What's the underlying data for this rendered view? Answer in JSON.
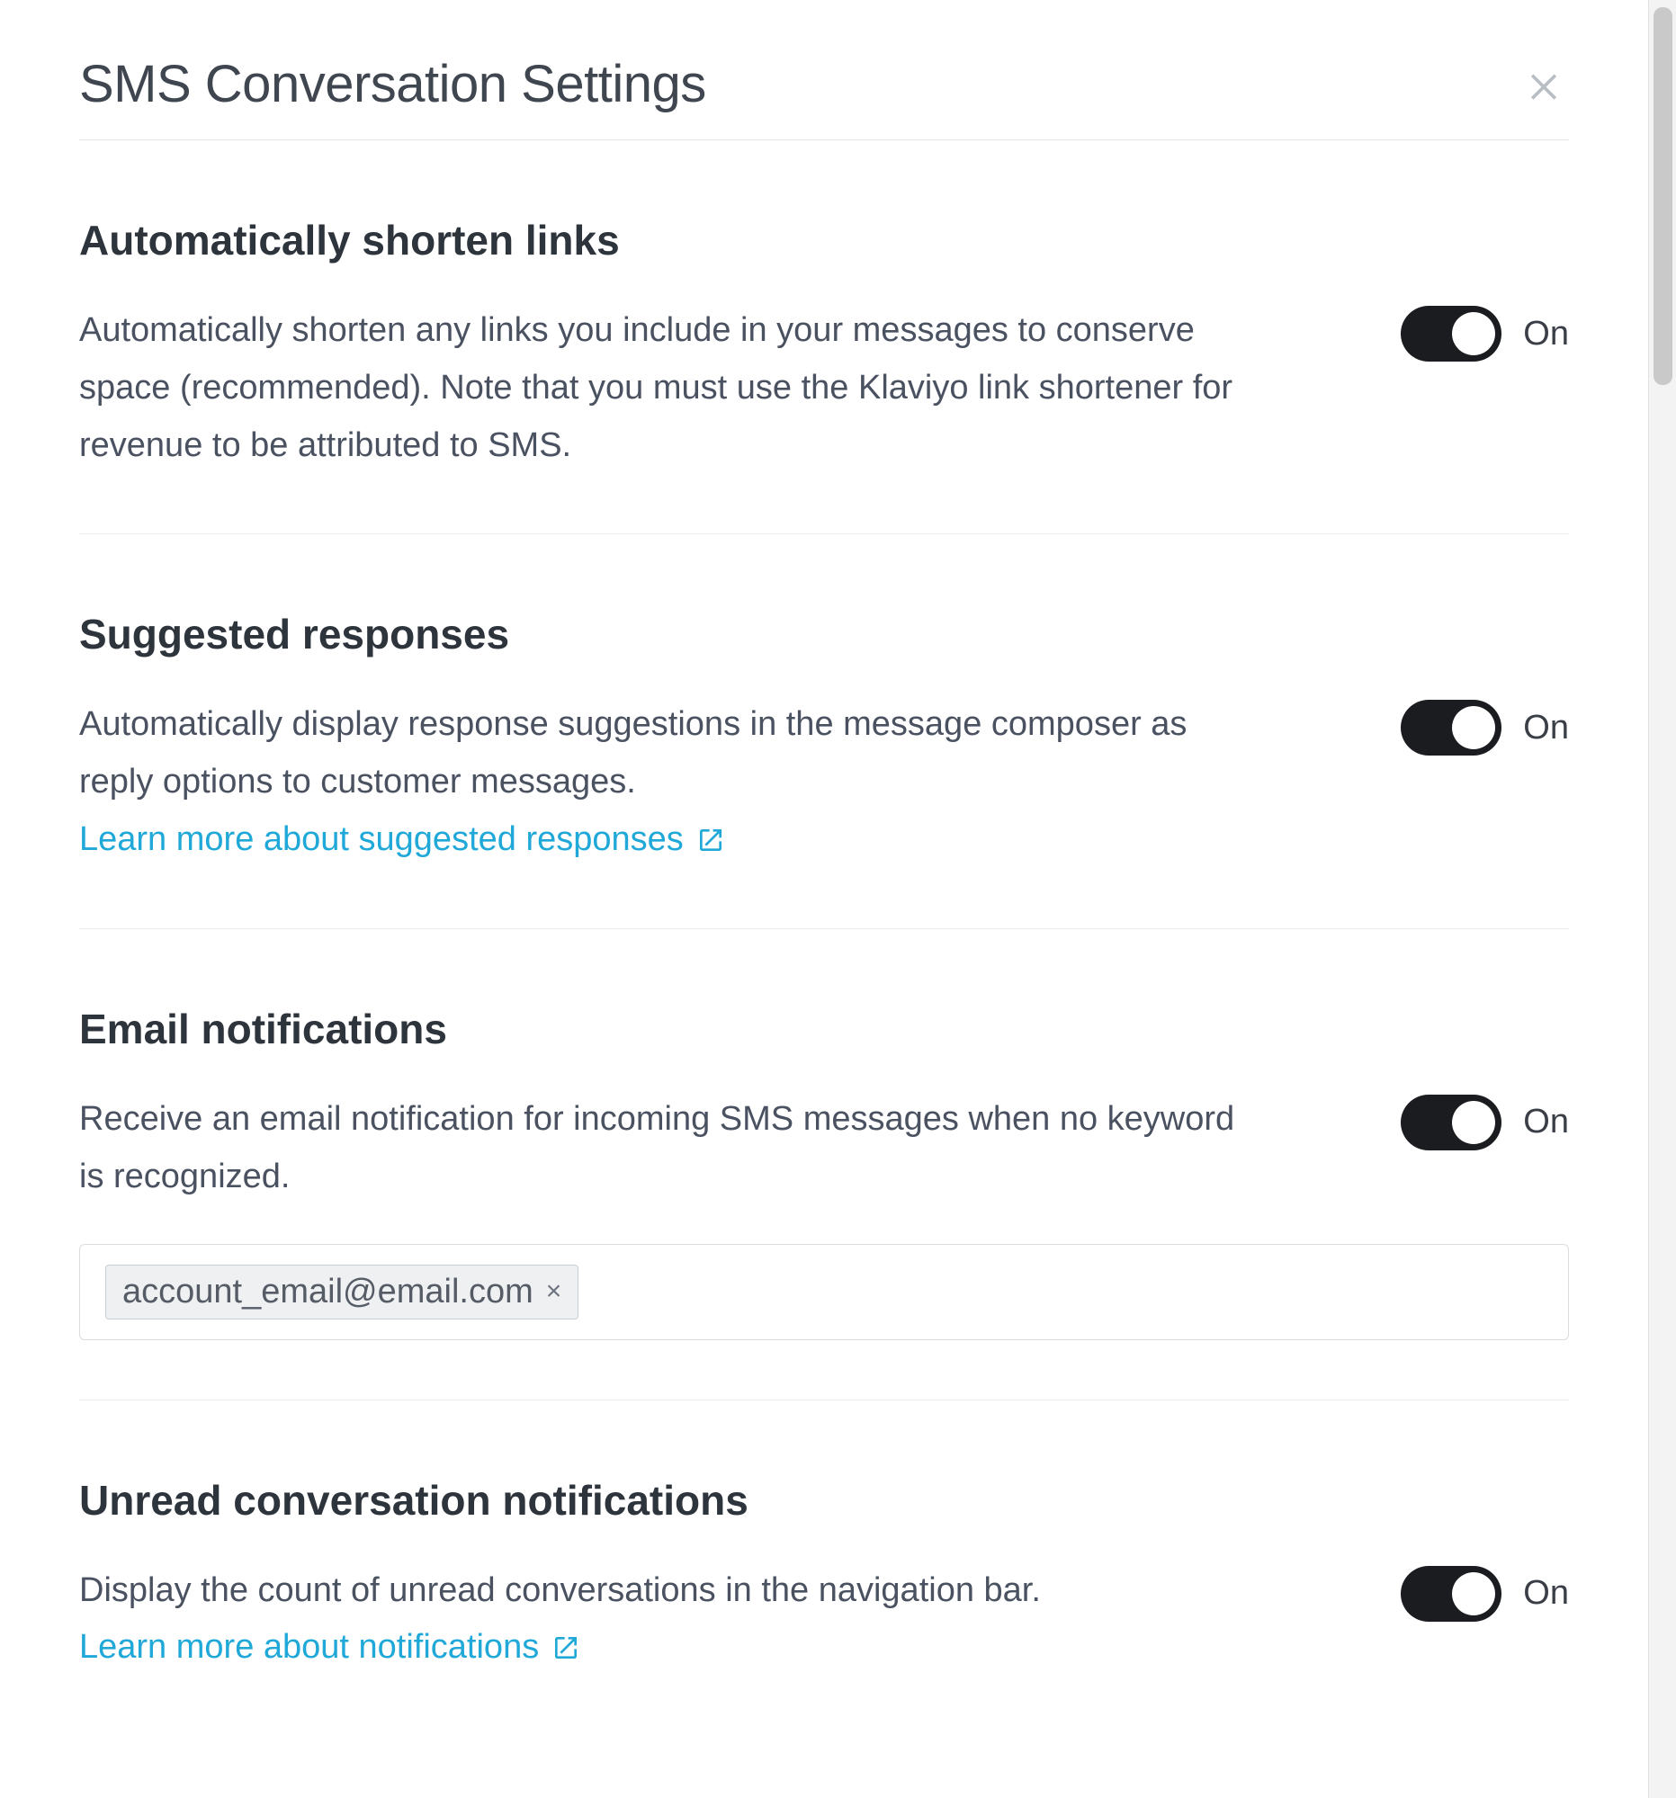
{
  "header": {
    "title": "SMS Conversation Settings"
  },
  "sections": {
    "shorten_links": {
      "title": "Automatically shorten links",
      "description": "Automatically shorten any links you include in your messages to conserve space (recommended). Note that you must use the Klaviyo link shortener for revenue to be attributed to SMS.",
      "toggle_state": "On"
    },
    "suggested_responses": {
      "title": "Suggested responses",
      "description": "Automatically display response suggestions in the message composer as reply options to customer messages.",
      "link_text": "Learn more about suggested responses",
      "toggle_state": "On"
    },
    "email_notifications": {
      "title": "Email notifications",
      "description": "Receive an email notification for incoming SMS messages when no keyword is recognized.",
      "toggle_state": "On",
      "emails": [
        "account_email@email.com"
      ]
    },
    "unread_notifications": {
      "title": "Unread conversation notifications",
      "description": "Display the count of unread conversations in the navigation bar.",
      "link_text": "Learn more about notifications",
      "toggle_state": "On"
    }
  }
}
